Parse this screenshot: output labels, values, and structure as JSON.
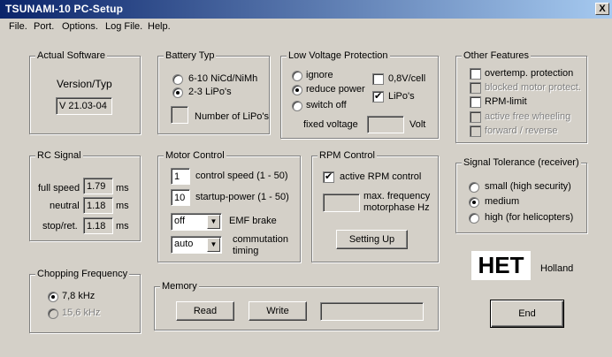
{
  "window": {
    "title": "TSUNAMI-10  PC-Setup",
    "close_label": "X"
  },
  "menu": [
    "File",
    "Port",
    "Options",
    "Log File",
    "Help"
  ],
  "actual_software": {
    "title": "Actual Software",
    "label": "Version/Typ",
    "value": "V 21.03-04"
  },
  "battery": {
    "title": "Battery Typ",
    "opt1": "6-10 NiCd/NiMh",
    "opt2": "2-3 LiPo's",
    "lipo_count_label": "Number of LiPo's"
  },
  "low_voltage": {
    "title": "Low Voltage Protection",
    "ignore": "ignore",
    "reduce": "reduce power",
    "switch_off": "switch off",
    "cell": "0,8V/cell",
    "lipos": "LiPo's",
    "fixed_voltage": "fixed voltage",
    "volt": "Volt"
  },
  "other_features": {
    "title": "Other Features",
    "overtemp": "overtemp. protection",
    "blocked": "blocked motor protect.",
    "rpm_limit": "RPM-limit",
    "free_wheeling": "active free wheeling",
    "forward_reverse": "forward / reverse"
  },
  "rc_signal": {
    "title": "RC Signal",
    "full_speed": "full speed",
    "full_speed_val": "1.79",
    "neutral": "neutral",
    "neutral_val": "1.18",
    "stop": "stop/ret.",
    "stop_val": "1.18",
    "unit": "ms"
  },
  "motor_control": {
    "title": "Motor Control",
    "control_speed_val": "1",
    "control_speed": "control speed (1 - 50)",
    "startup_val": "10",
    "startup": "startup-power (1 - 50)",
    "emf_val": "off",
    "emf": "EMF brake",
    "commutation_val": "auto",
    "commutation_1": "commutation",
    "commutation_2": "timing"
  },
  "rpm_control": {
    "title": "RPM Control",
    "active": "active RPM control",
    "max_freq_1": "max. frequency",
    "max_freq_2": "motorphase Hz",
    "setting_up": "Setting Up"
  },
  "signal_tolerance": {
    "title": "Signal Tolerance (receiver)",
    "small": "small (high security)",
    "medium": "medium",
    "high": "high (for helicopters)"
  },
  "chopping": {
    "title": "Chopping Frequency",
    "f1": "7,8 kHz",
    "f2": "15,6 kHz"
  },
  "memory": {
    "title": "Memory",
    "read": "Read",
    "write": "Write"
  },
  "brand": {
    "logo": "HET",
    "country": "Holland"
  },
  "end_button": "End"
}
